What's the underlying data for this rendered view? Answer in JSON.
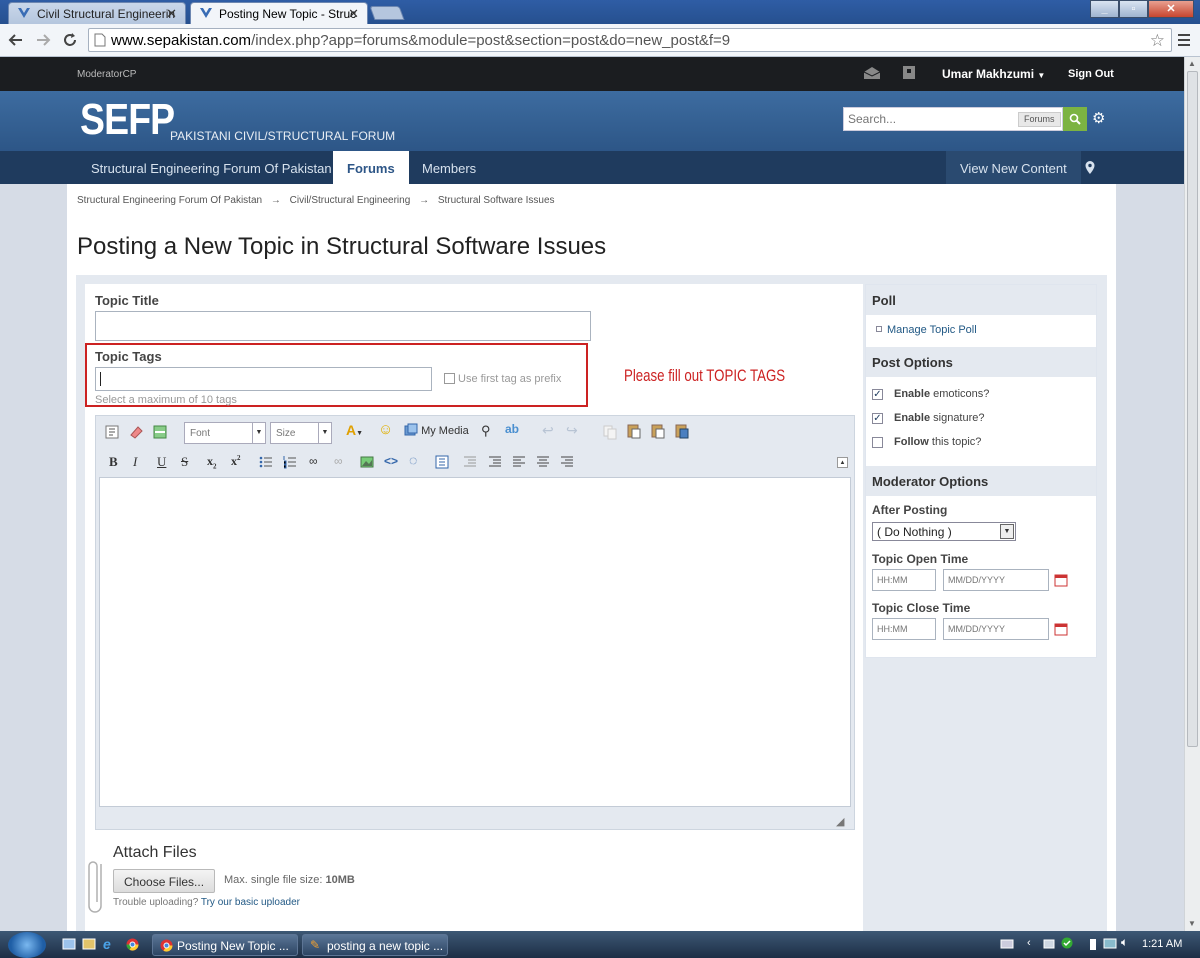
{
  "browser": {
    "tabs": [
      {
        "title": "Civil Structural Engineerin",
        "active": false
      },
      {
        "title": "Posting New Topic - Struc",
        "active": true
      }
    ],
    "url_host": "www.sepakistan.com",
    "url_path": "/index.php?app=forums&module=post&section=post&do=new_post&f=9"
  },
  "userbar": {
    "moderator_cp": "ModeratorCP",
    "username": "Umar Makhzumi",
    "sign_out": "Sign Out"
  },
  "branding": {
    "logo": "SEFP",
    "tagline": "PAKISTANI CIVIL/STRUCTURAL FORUM",
    "search_placeholder": "Search...",
    "search_scope": "Forums"
  },
  "nav": {
    "items": [
      "Structural Engineering Forum Of Pakistan",
      "Forums",
      "Members"
    ],
    "active_index": 1,
    "view_new_content": "View New Content"
  },
  "breadcrumb": [
    "Structural Engineering Forum Of Pakistan",
    "Civil/Structural Engineering",
    "Structural Software Issues"
  ],
  "page_title": "Posting a New Topic in Structural Software Issues",
  "form": {
    "topic_title_label": "Topic Title",
    "topic_tags_label": "Topic Tags",
    "use_first_tag_label": "Use first tag as prefix",
    "tags_hint": "Select a maximum of 10 tags",
    "annotation": "Please fill out TOPIC TAGS",
    "annotation_color": "#cc2222",
    "font_select": "Font",
    "size_select": "Size",
    "my_media": "My Media"
  },
  "attach": {
    "title": "Attach Files",
    "choose_button": "Choose Files...",
    "max_size_label": "Max. single file size:",
    "max_size_value": "10MB",
    "trouble_text": "Trouble uploading?",
    "basic_uploader_link": "Try our basic uploader"
  },
  "sidebar": {
    "poll_header": "Poll",
    "manage_poll": "Manage Topic Poll",
    "post_options_header": "Post Options",
    "options": [
      {
        "bold": "Enable",
        "rest": " emoticons?",
        "checked": true
      },
      {
        "bold": "Enable",
        "rest": " signature?",
        "checked": true
      },
      {
        "bold": "Follow",
        "rest": " this topic?",
        "checked": false
      }
    ],
    "moderator_header": "Moderator Options",
    "after_posting_label": "After Posting",
    "after_posting_value": "( Do Nothing )",
    "open_time_label": "Topic Open Time",
    "close_time_label": "Topic Close Time",
    "time_placeholder": "HH:MM",
    "date_placeholder": "MM/DD/YYYY"
  },
  "taskbar": {
    "tasks": [
      "Posting New Topic ...",
      "posting a new topic ..."
    ],
    "clock": "1:21 AM"
  },
  "colors": {
    "brand_blue": "#2d5687",
    "nav_dark": "#1f3b5e",
    "search_green": "#7cb342",
    "link_blue": "#225985"
  }
}
